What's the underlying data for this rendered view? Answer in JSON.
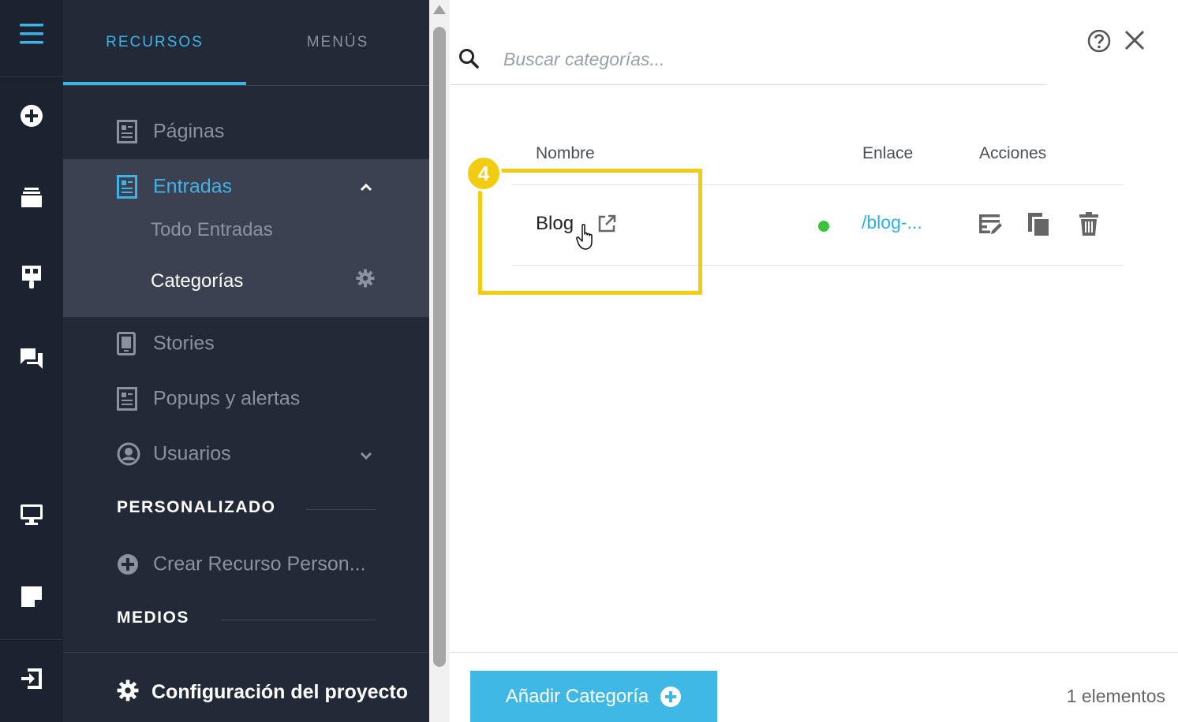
{
  "sidebar": {
    "tabs": [
      {
        "label": "RECURSOS",
        "active": true
      },
      {
        "label": "MENÚS",
        "active": false
      }
    ],
    "items": [
      {
        "label": "Páginas",
        "icon": "page-icon"
      },
      {
        "label": "Entradas",
        "icon": "entries-icon",
        "expanded": true
      },
      {
        "label": "Stories",
        "icon": "stories-icon"
      },
      {
        "label": "Popups y alertas",
        "icon": "popup-icon"
      },
      {
        "label": "Usuarios",
        "icon": "user-icon"
      }
    ],
    "entradas_sub": [
      {
        "label": "Todo Entradas",
        "active": false
      },
      {
        "label": "Categorías",
        "active": true
      }
    ],
    "sections": {
      "custom": "PERSONALIZADO",
      "create_custom": "Crear Recurso Person...",
      "media": "MEDIOS"
    },
    "config_label": "Configuración del proyecto"
  },
  "search": {
    "placeholder": "Buscar categorías..."
  },
  "table": {
    "headers": {
      "name": "Nombre",
      "link": "Enlace",
      "actions": "Acciones"
    },
    "rows": [
      {
        "name": "Blog",
        "status": "published",
        "link": "/blog-..."
      }
    ]
  },
  "annotation": {
    "step": "4"
  },
  "footer": {
    "add_button": "Añadir Categoría",
    "count": "1 elementos"
  },
  "colors": {
    "accent": "#3fb3e6",
    "highlight": "#f2cc12",
    "status_green": "#3bc43b",
    "rail_bg": "#1b2230",
    "panel_bg": "#232a37",
    "active_group_bg": "#3b4150"
  }
}
